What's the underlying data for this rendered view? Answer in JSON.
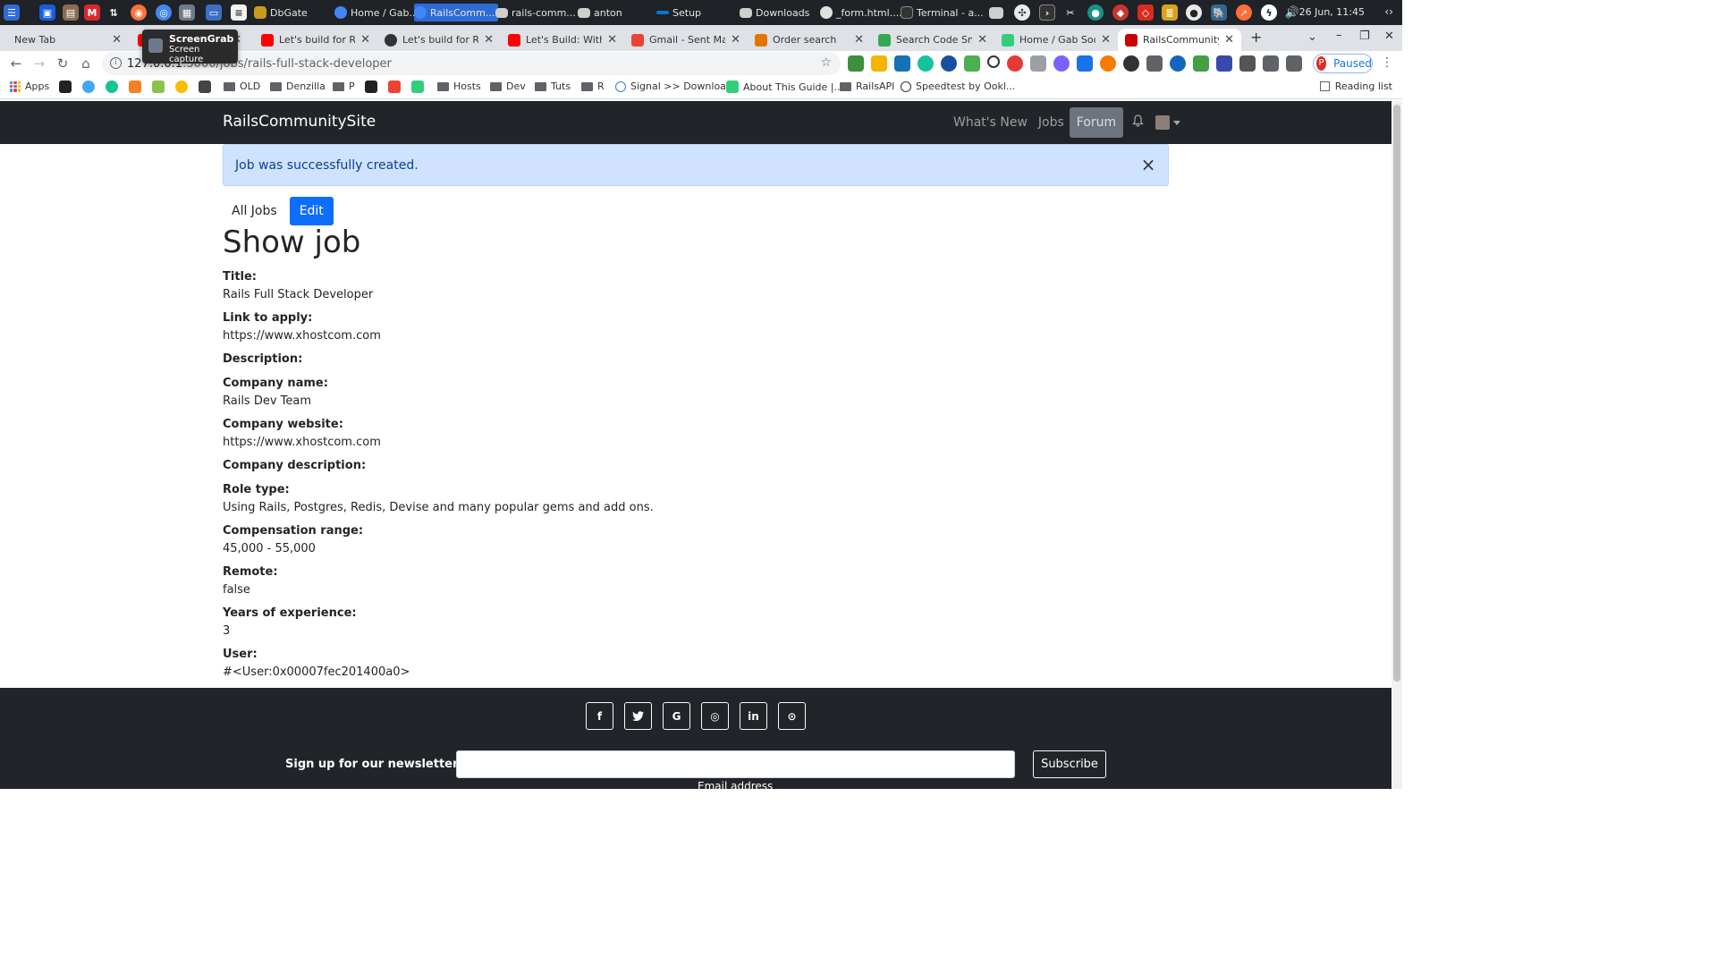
{
  "taskbar": {
    "windows": [
      {
        "label": "DbGate",
        "color": "#c99a1c"
      },
      {
        "label": "Home / Gab...",
        "color": "#4285f4"
      },
      {
        "label": "RailsComm...",
        "color": "#4285f4",
        "active": true
      },
      {
        "label": "rails-comm...",
        "color": "#cfcfcf"
      },
      {
        "label": "anton",
        "color": "#cfcfcf"
      },
      {
        "label": "Setup",
        "color": "#0078d4"
      },
      {
        "label": "Downloads",
        "color": "#cfcfcf"
      },
      {
        "label": "_form.html....",
        "color": "#e0e0e0"
      },
      {
        "label": "Terminal - a...",
        "color": "#333333"
      }
    ],
    "clock": "26 Jun, 11:45"
  },
  "tooltip": {
    "title": "ScreenGrab",
    "subtitle": "Screen capture"
  },
  "tabs": [
    {
      "label": "New Tab",
      "icon": "none"
    },
    {
      "label": "Let's build for Ruby",
      "icon": "youtube-icon",
      "color": "#ff0000"
    },
    {
      "label": "Let's build for Ruby",
      "icon": "github-icon",
      "color": "#333333"
    },
    {
      "label": "Let's Build: With Ru",
      "icon": "youtube-icon",
      "color": "#ff0000"
    },
    {
      "label": "Gmail - Sent Mail",
      "icon": "gmail-icon",
      "color": "#ea4335"
    },
    {
      "label": "Order search",
      "icon": "lock-icon",
      "color": "#e37400"
    },
    {
      "label": "Search Code Snipp",
      "icon": "code-icon",
      "color": "#34a853"
    },
    {
      "label": "Home / Gab Social",
      "icon": "gab-icon",
      "color": "#30ce7d"
    },
    {
      "label": "RailsCommunitySit",
      "icon": "rails-icon",
      "color": "#cc0000",
      "active": true
    }
  ],
  "address_bar": {
    "host": "127.0.0.1",
    "port_path": ":3000/jobs/rails-full-stack-developer"
  },
  "profile": {
    "initial": "P",
    "status": "Paused"
  },
  "bookmarks": [
    {
      "label": "Apps",
      "kind": "apps"
    },
    {
      "label": "OLD",
      "kind": "folder"
    },
    {
      "label": "Denzilla",
      "kind": "folder"
    },
    {
      "label": "P",
      "kind": "folder"
    },
    {
      "label": "Hosts",
      "kind": "folder"
    },
    {
      "label": "Dev",
      "kind": "folder"
    },
    {
      "label": "Tuts",
      "kind": "folder"
    },
    {
      "label": "R",
      "kind": "folder"
    },
    {
      "label": "Signal >> Downloa...",
      "kind": "site"
    },
    {
      "label": "About This Guide |...",
      "kind": "site"
    },
    {
      "label": "RailsAPI",
      "kind": "folder"
    },
    {
      "label": "Speedtest by Ookl...",
      "kind": "site"
    }
  ],
  "reading_list": "Reading list",
  "site": {
    "brand": "RailsCommunitySite",
    "nav": [
      {
        "label": "What's New"
      },
      {
        "label": "Jobs"
      },
      {
        "label": "Forum",
        "active": true
      }
    ]
  },
  "alert": {
    "message": "Job was successfully created.",
    "close": "×"
  },
  "actions": {
    "all_jobs": "All Jobs",
    "edit": "Edit"
  },
  "page_title": "Show job",
  "job_fields": [
    {
      "label": "Title:",
      "value": "Rails Full Stack Developer"
    },
    {
      "label": "Link to apply:",
      "value": "https://www.xhostcom.com"
    },
    {
      "label": "Description:",
      "value": ""
    },
    {
      "label": "Company name:",
      "value": "Rails Dev Team"
    },
    {
      "label": "Company website:",
      "value": "https://www.xhostcom.com"
    },
    {
      "label": "Company description:",
      "value": ""
    },
    {
      "label": "Role type:",
      "value": "Using Rails, Postgres, Redis, Devise and many popular gems and add ons."
    },
    {
      "label": "Compensation range:",
      "value": "45,000 - 55,000"
    },
    {
      "label": "Remote:",
      "value": "false"
    },
    {
      "label": "Years of experience:",
      "value": "3"
    },
    {
      "label": "User:",
      "value": "#<User:0x00007fec201400a0>"
    }
  ],
  "footer": {
    "social": [
      {
        "name": "facebook-icon",
        "glyph": "f"
      },
      {
        "name": "twitter-icon",
        "glyph": "t"
      },
      {
        "name": "google-icon",
        "glyph": "G"
      },
      {
        "name": "instagram-icon",
        "glyph": "◎"
      },
      {
        "name": "linkedin-icon",
        "glyph": "in"
      },
      {
        "name": "github-icon",
        "glyph": "⊙"
      }
    ],
    "newsletter_label": "Sign up for our newsletter",
    "email_placeholder": "",
    "email_help": "Email address",
    "subscribe": "Subscribe"
  }
}
